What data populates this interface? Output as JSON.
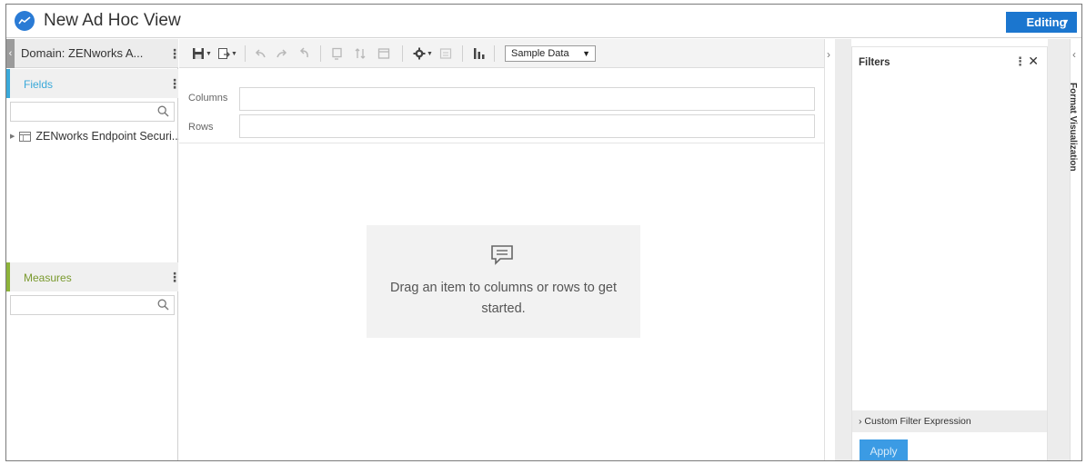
{
  "app": {
    "title": "New Ad Hoc View",
    "mode_label": "Editing",
    "accent_color": "#1b76cf"
  },
  "left_panel": {
    "domain_label": "Domain: ZENworks A...",
    "fields": {
      "label": "Fields",
      "accent_color": "#3aa9d9",
      "search_placeholder": "",
      "items": [
        {
          "label": "ZENworks Endpoint Securi...",
          "icon": "table-icon"
        }
      ]
    },
    "measures": {
      "label": "Measures",
      "accent_color": "#8db33a",
      "search_placeholder": ""
    }
  },
  "toolbar": {
    "icons": [
      "save-icon",
      "export-icon",
      "undo-icon",
      "redo-icon",
      "undo-all-icon",
      "pivot-icon",
      "sort-icon",
      "layout-icon",
      "options-icon",
      "disabled-icon",
      "chart-type-icon"
    ],
    "sample_data_option": "Sample Data"
  },
  "canvas": {
    "columns_label": "Columns",
    "rows_label": "Rows",
    "empty_message": "Drag an item to columns or rows to get started."
  },
  "filters": {
    "title": "Filters",
    "custom_filter_label": "Custom Filter Expression",
    "apply_label": "Apply"
  },
  "side_tab": {
    "label": "Format Visualization"
  }
}
